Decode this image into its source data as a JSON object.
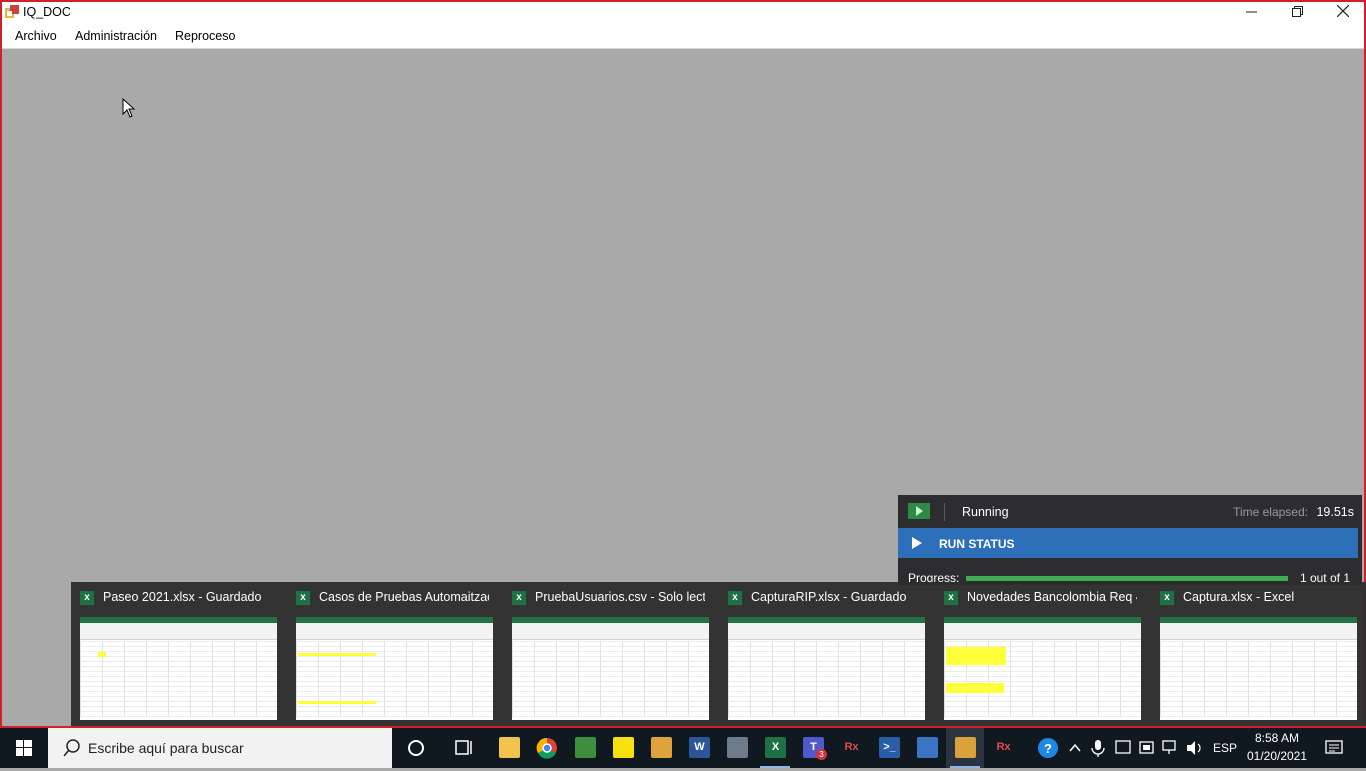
{
  "window": {
    "title": "IQ_DOC",
    "menu": [
      "Archivo",
      "Administración",
      "Reproceso"
    ]
  },
  "run_panel": {
    "state": "Running",
    "elapsed_label": "Time elapsed:",
    "elapsed_value": "19.51s",
    "status_label": "RUN STATUS",
    "progress_label": "Progress:",
    "progress_fraction": 1.0,
    "progress_count": "1 out of 1",
    "colors": {
      "panel": "#2d2d2f",
      "status_bar": "#2e6fb9",
      "progress": "#3fae53"
    }
  },
  "previews": [
    {
      "icon": "excel-icon",
      "title": "Paseo 2021.xlsx - Guardado"
    },
    {
      "icon": "excel-icon",
      "title": "Casos de Pruebas Automaitzaci..."
    },
    {
      "icon": "excel-icon",
      "title": "PruebaUsuarios.csv  -  Solo lect..."
    },
    {
      "icon": "excel-icon",
      "title": "CapturaRIP.xlsx - Guardado"
    },
    {
      "icon": "excel-icon",
      "title": "Novedades Bancolombia Req 4..."
    },
    {
      "icon": "excel-icon",
      "title": "Captura.xlsx - Excel"
    }
  ],
  "taskbar": {
    "search_placeholder": "Escribe aquí para buscar",
    "apps": [
      {
        "icon": "cortana-icon"
      },
      {
        "icon": "task-view-icon"
      },
      {
        "icon": "file-explorer-icon"
      },
      {
        "icon": "chrome-icon"
      },
      {
        "icon": "project-icon"
      },
      {
        "icon": "sticky-notes-icon"
      },
      {
        "icon": "sync-icon"
      },
      {
        "icon": "word-icon",
        "letter": "W"
      },
      {
        "icon": "remote-desktop-icon"
      },
      {
        "icon": "excel-icon",
        "letter": "X"
      },
      {
        "icon": "teams-icon",
        "letter": "T",
        "badge": "3"
      },
      {
        "icon": "rx-tool-icon",
        "letter": "Rx"
      },
      {
        "icon": "powershell-icon",
        "letter": ">_"
      },
      {
        "icon": "remote-desktop-connection-icon"
      },
      {
        "icon": "iq-doc-icon"
      },
      {
        "icon": "rx-tool-icon",
        "letter": "Rx"
      }
    ],
    "language": "ESP",
    "time": "8:58 AM",
    "date": "01/20/2021"
  }
}
